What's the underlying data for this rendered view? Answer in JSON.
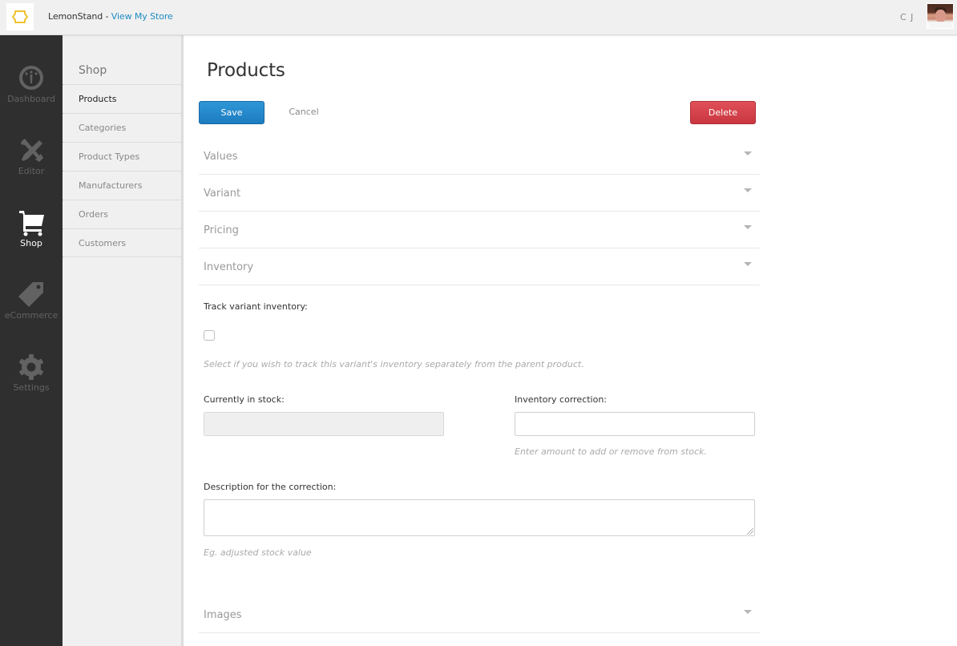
{
  "topbar": {
    "brand": "LemonStand",
    "separator": " - ",
    "view_store_link": "View My Store",
    "user_initials": "C J",
    "logo_icon": "lemonstand-logo-icon",
    "avatar_icon": "user-avatar"
  },
  "colors": {
    "accent": "#1e8bc3",
    "save": "#2185c8",
    "delete": "#d5434c",
    "logo": "#f0c22e",
    "dark_nav": "#2f2f2f"
  },
  "main_nav": {
    "items": [
      {
        "label": "Dashboard",
        "icon": "dashboard-gauge-icon",
        "active": false
      },
      {
        "label": "Editor",
        "icon": "tools-wrench-pencil-icon",
        "active": false
      },
      {
        "label": "Shop",
        "icon": "shopping-cart-icon",
        "active": true
      },
      {
        "label": "eCommerce",
        "icon": "price-tag-icon",
        "active": false
      },
      {
        "label": "Settings",
        "icon": "gear-icon",
        "active": false
      }
    ]
  },
  "sub_nav": {
    "title": "Shop",
    "items": [
      {
        "label": "Products",
        "active": true
      },
      {
        "label": "Categories",
        "active": false
      },
      {
        "label": "Product Types",
        "active": false
      },
      {
        "label": "Manufacturers",
        "active": false
      },
      {
        "label": "Orders",
        "active": false
      },
      {
        "label": "Customers",
        "active": false
      }
    ]
  },
  "page": {
    "title": "Products",
    "save_label": "Save",
    "cancel_label": "Cancel",
    "delete_label": "Delete"
  },
  "sections": [
    {
      "title": "Values",
      "icon": "caret-down-icon"
    },
    {
      "title": "Variant",
      "icon": "caret-down-icon"
    },
    {
      "title": "Pricing",
      "icon": "caret-down-icon"
    },
    {
      "title": "Inventory",
      "icon": "caret-down-icon"
    },
    {
      "title": "Images",
      "icon": "caret-down-icon"
    }
  ],
  "inventory": {
    "track_label": "Track variant inventory:",
    "track_checked": false,
    "track_help": "Select if you wish to track this variant's inventory separately from the parent product.",
    "in_stock_label": "Currently in stock:",
    "in_stock_value": "",
    "correction_label": "Inventory correction:",
    "correction_value": "",
    "correction_help": "Enter amount to add or remove from stock.",
    "description_label": "Description for the correction:",
    "description_value": "",
    "description_help": "Eg. adjusted stock value"
  }
}
